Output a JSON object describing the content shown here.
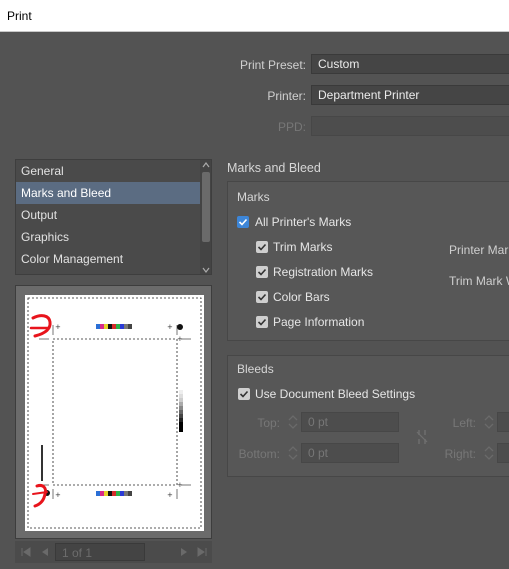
{
  "window": {
    "title": "Print"
  },
  "header": {
    "print_preset_label": "Print Preset:",
    "print_preset_value": "Custom",
    "printer_label": "Printer:",
    "printer_value": "Department Printer",
    "ppd_label": "PPD:",
    "ppd_value": ""
  },
  "categories": {
    "items": [
      {
        "label": "General"
      },
      {
        "label": "Marks and Bleed",
        "selected": true
      },
      {
        "label": "Output"
      },
      {
        "label": "Graphics"
      },
      {
        "label": "Color Management"
      }
    ]
  },
  "panel": {
    "title": "Marks and Bleed"
  },
  "marks": {
    "title": "Marks",
    "all_printers_marks": {
      "label": "All Printer's Marks",
      "checked": true
    },
    "trim_marks": {
      "label": "Trim Marks",
      "checked": true
    },
    "registration_marks": {
      "label": "Registration Marks",
      "checked": true
    },
    "color_bars": {
      "label": "Color Bars",
      "checked": true
    },
    "page_information": {
      "label": "Page Information",
      "checked": true
    },
    "printer_mark_type_label": "Printer Mark",
    "trim_mark_weight_label": "Trim Mark W"
  },
  "bleeds": {
    "title": "Bleeds",
    "use_document_bleed": {
      "label": "Use Document Bleed Settings",
      "checked": true
    },
    "top_label": "Top:",
    "top_value": "0 pt",
    "bottom_label": "Bottom:",
    "bottom_value": "0 pt",
    "left_label": "Left:",
    "right_label": "Right:"
  },
  "pager": {
    "value": "1 of 1"
  },
  "colors": {
    "background": "#535353",
    "accent": "#3d86d8",
    "selection": "#5b6c82",
    "annotation": "#e8141c"
  }
}
